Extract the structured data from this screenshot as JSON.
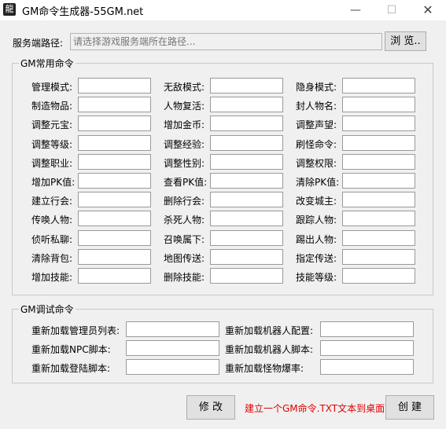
{
  "window": {
    "title": "GM命令生成器-55GM.net",
    "icon": "app-icon"
  },
  "server_path": {
    "label": "服务端路径:",
    "placeholder": "请选择游戏服务端所在路径...",
    "browse_label": "浏 览.."
  },
  "common_group": {
    "title": "GM常用命令",
    "fields": [
      [
        "管理模式:",
        "无敌模式:",
        "隐身模式:"
      ],
      [
        "制造物品:",
        "人物复活:",
        "封人物名:"
      ],
      [
        "调整元宝:",
        "增加金币:",
        "调整声望:"
      ],
      [
        "调整等级:",
        "调整经验:",
        "刷怪命令:"
      ],
      [
        "调整职业:",
        "调整性别:",
        "调整权限:"
      ],
      [
        "增加PK值:",
        "查看PK值:",
        "清除PK值:"
      ],
      [
        "建立行会:",
        "删除行会:",
        "改变城主:"
      ],
      [
        "传唤人物:",
        "杀死人物:",
        "跟踪人物:"
      ],
      [
        "侦听私聊:",
        "召唤属下:",
        "踢出人物:"
      ],
      [
        "清除背包:",
        "地图传送:",
        "指定传送:"
      ],
      [
        "增加技能:",
        "删除技能:",
        "技能等级:"
      ]
    ]
  },
  "debug_group": {
    "title": "GM调试命令",
    "fields": [
      [
        "重新加载管理员列表:",
        "重新加载机器人配置:"
      ],
      [
        "重新加载NPC脚本:",
        "重新加载机器人脚本:"
      ],
      [
        "重新加载登陆脚本:",
        "重新加载怪物爆率:"
      ]
    ]
  },
  "footer": {
    "modify_label": "修 改",
    "hint": "建立一个GM命令.TXT文本到桌面",
    "create_label": "创 建"
  }
}
